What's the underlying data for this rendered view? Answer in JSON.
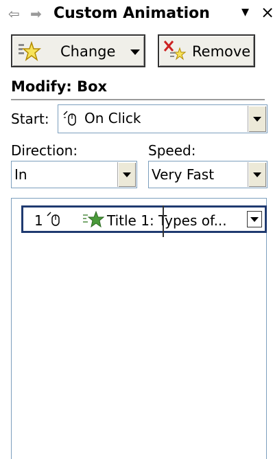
{
  "titlebar": {
    "title": "Custom Animation",
    "back_icon": "back-arrow-icon",
    "forward_icon": "forward-arrow-icon",
    "menu_icon": "dropdown-arrow-icon",
    "close_icon": "close-icon",
    "back_glyph": "⇦",
    "forward_glyph": "➡",
    "menu_glyph": "▾",
    "close_glyph": "×"
  },
  "toolbar": {
    "change_label": "Change",
    "remove_label": "Remove"
  },
  "modify": {
    "heading": "Modify: Box",
    "start_label": "Start:",
    "start_value": "On Click",
    "direction_label": "Direction:",
    "direction_value": "In",
    "speed_label": "Speed:",
    "speed_value": "Very Fast"
  },
  "list": {
    "items": [
      {
        "order": "1",
        "text": "Title 1: Types of..."
      }
    ]
  },
  "colors": {
    "selection_border": "#1f3a70",
    "star_green": "#4a9a3a",
    "remove_red": "#cc2222"
  }
}
